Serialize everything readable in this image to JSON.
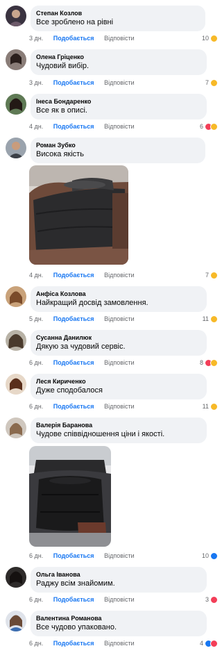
{
  "labels": {
    "like": "Подобається",
    "reply": "Відповісти"
  },
  "colors": {
    "bubble": "#f0f2f5",
    "like_blue": "#1877f2",
    "meta_gray": "#65676b",
    "wow_yellow": "#f7b928",
    "love_red": "#f33e58"
  },
  "comments": [
    {
      "author": "Степан Козлов",
      "text": "Все зроблено на рівні",
      "time": "3 дн.",
      "reactions": "10",
      "icons": [
        "wow-icon"
      ]
    },
    {
      "author": "Олена Гріценко",
      "text": "Чудовий вибір.",
      "time": "3 дн.",
      "reactions": "7",
      "icons": [
        "wow-icon"
      ]
    },
    {
      "author": "Інеса Бондаренко",
      "text": "Все як в описі.",
      "time": "4 дн.",
      "reactions": "6",
      "icons": [
        "love-icon",
        "wow-icon"
      ]
    },
    {
      "author": "Роман Зубко",
      "text": "Висока якість",
      "time": "4 дн.",
      "reactions": "7",
      "icons": [
        "wow-icon"
      ],
      "photo": "car-air-mattress-grey-photo"
    },
    {
      "author": "Анфіса Козлова",
      "text": "Найкращий досвід замовлення.",
      "time": "5 дн.",
      "reactions": "11",
      "icons": [
        "wow-icon"
      ]
    },
    {
      "author": "Сусанна Данилюк",
      "text": "Дякую за чудовий сервіс.",
      "time": "6 дн.",
      "reactions": "8",
      "icons": [
        "love-icon",
        "wow-icon"
      ]
    },
    {
      "author": "Леся Кириченко",
      "text": "Дуже сподобалося",
      "time": "6 дн.",
      "reactions": "11",
      "icons": [
        "wow-icon"
      ]
    },
    {
      "author": "Валерія Баранова",
      "text": "Чудове співвідношення ціни і якості.",
      "time": "6 дн.",
      "reactions": "10",
      "icons": [
        "like-icon"
      ],
      "photo": "car-air-mattress-black-photo"
    },
    {
      "author": "Ольга Іванова",
      "text": "Раджу всім знайомим.",
      "time": "6 дн.",
      "reactions": "3",
      "icons": [
        "love-icon"
      ]
    },
    {
      "author": "Валентина Романова",
      "text": "Все чудово упаковано.",
      "time": "6 дн.",
      "reactions": "4",
      "icons": [
        "like-icon",
        "love-icon"
      ]
    }
  ]
}
